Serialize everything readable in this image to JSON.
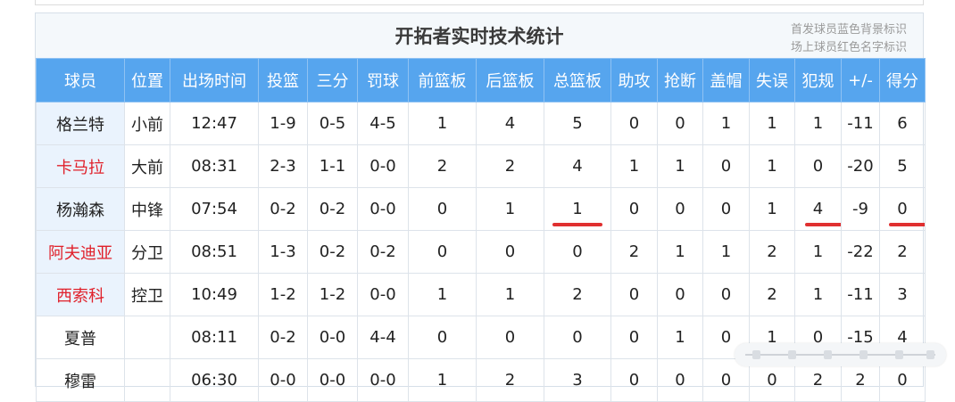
{
  "title": "开拓者实时技术统计",
  "notes": [
    "首发球员蓝色背景标识",
    "场上球员红色名字标识"
  ],
  "columns": [
    "球员",
    "位置",
    "出场时间",
    "投篮",
    "三分",
    "罚球",
    "前篮板",
    "后篮板",
    "总篮板",
    "助攻",
    "抢断",
    "盖帽",
    "失误",
    "犯规",
    "+/-",
    "得分"
  ],
  "rows": [
    {
      "starter": true,
      "on_court": false,
      "cells": [
        "格兰特",
        "小前",
        "12:47",
        "1-9",
        "0-5",
        "4-5",
        "1",
        "4",
        "5",
        "0",
        "0",
        "1",
        "1",
        "1",
        "-11",
        "6"
      ]
    },
    {
      "starter": true,
      "on_court": true,
      "cells": [
        "卡马拉",
        "大前",
        "08:31",
        "2-3",
        "1-1",
        "0-0",
        "2",
        "2",
        "4",
        "1",
        "1",
        "0",
        "1",
        "0",
        "-20",
        "5"
      ]
    },
    {
      "starter": true,
      "on_court": false,
      "cells": [
        "杨瀚森",
        "中锋",
        "07:54",
        "0-2",
        "0-2",
        "0-0",
        "0",
        "1",
        "1",
        "0",
        "0",
        "0",
        "1",
        "4",
        "-9",
        "0"
      ]
    },
    {
      "starter": true,
      "on_court": true,
      "cells": [
        "阿夫迪亚",
        "分卫",
        "08:51",
        "1-3",
        "0-2",
        "0-2",
        "0",
        "0",
        "0",
        "2",
        "1",
        "1",
        "2",
        "1",
        "-22",
        "2"
      ]
    },
    {
      "starter": true,
      "on_court": true,
      "cells": [
        "西索科",
        "控卫",
        "10:49",
        "1-2",
        "1-2",
        "0-0",
        "1",
        "1",
        "2",
        "0",
        "0",
        "0",
        "2",
        "1",
        "-11",
        "3"
      ]
    },
    {
      "starter": false,
      "on_court": false,
      "cells": [
        "夏普",
        "",
        "08:11",
        "0-2",
        "0-0",
        "4-4",
        "0",
        "0",
        "0",
        "0",
        "1",
        "0",
        "1",
        "0",
        "-15",
        "4"
      ]
    },
    {
      "starter": false,
      "on_court": false,
      "cells": [
        "穆雷",
        "",
        "06:30",
        "0-0",
        "0-0",
        "0-0",
        "1",
        "2",
        "3",
        "0",
        "0",
        "0",
        "0",
        "2",
        "2",
        "0"
      ]
    }
  ],
  "highlight_color": "#e03030",
  "header_color": "#56a5ee",
  "starter_bg_color": "#eaf3fd",
  "on_court_name_color": "#e0202a"
}
